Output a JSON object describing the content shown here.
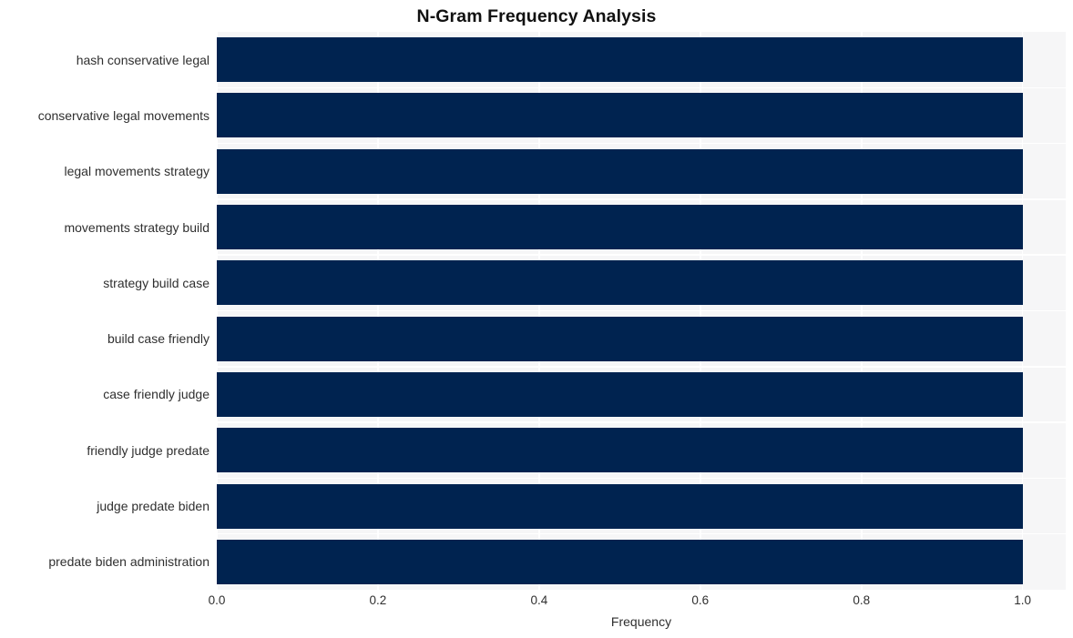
{
  "chart_data": {
    "type": "bar",
    "orientation": "horizontal",
    "title": "N-Gram Frequency Analysis",
    "xlabel": "Frequency",
    "ylabel": "",
    "categories": [
      "hash conservative legal",
      "conservative legal movements",
      "legal movements strategy",
      "movements strategy build",
      "strategy build case",
      "build case friendly",
      "case friendly judge",
      "friendly judge predate",
      "judge predate biden",
      "predate biden administration"
    ],
    "values": [
      1.0,
      1.0,
      1.0,
      1.0,
      1.0,
      1.0,
      1.0,
      1.0,
      1.0,
      1.0
    ],
    "xlim": [
      0.0,
      1.0535
    ],
    "xticks": [
      0.0,
      0.2,
      0.4,
      0.6,
      0.8,
      1.0
    ],
    "xticklabels": [
      "0.0",
      "0.2",
      "0.4",
      "0.6",
      "0.8",
      "1.0"
    ],
    "grid": true,
    "grid_color": "#ffffff",
    "legend": null,
    "bar_color": "#002350",
    "plot_background": "#f6f6f7",
    "figure_background": "#ffffff"
  }
}
